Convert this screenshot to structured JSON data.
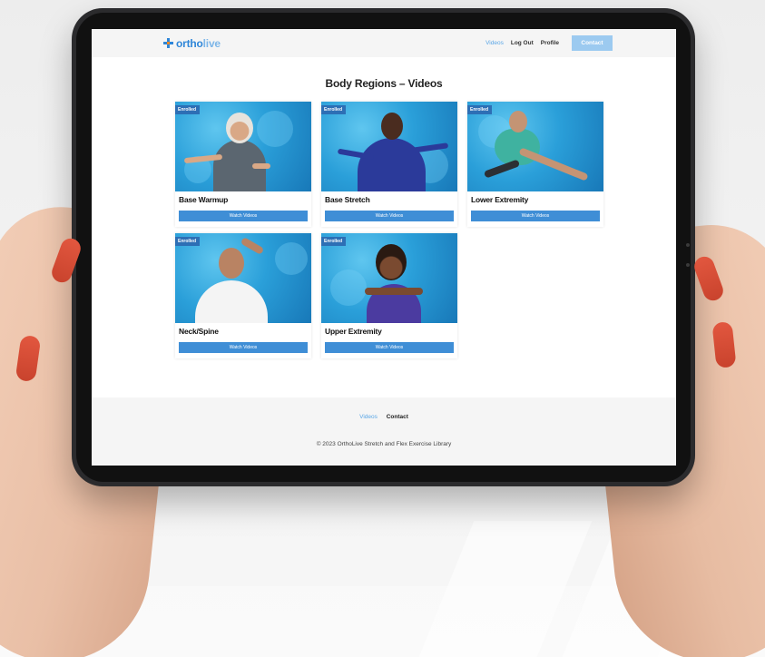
{
  "site": {
    "logo_brand": "ortho",
    "logo_rest": "live"
  },
  "nav": {
    "items": [
      {
        "label": "Videos",
        "active": true
      },
      {
        "label": "Log Out",
        "active": false
      },
      {
        "label": "Profile",
        "active": false
      }
    ],
    "contact_label": "Contact"
  },
  "main": {
    "title": "Body Regions – Videos",
    "cards": [
      {
        "title": "Base Warmup",
        "badge": "Enrolled",
        "button": "Watch Videos"
      },
      {
        "title": "Base Stretch",
        "badge": "Enrolled",
        "button": "Watch Videos"
      },
      {
        "title": "Lower Extremity",
        "badge": "Enrolled",
        "button": "Watch Videos"
      },
      {
        "title": "Neck/Spine",
        "badge": "Enrolled",
        "button": "Watch Videos"
      },
      {
        "title": "Upper Extremity",
        "badge": "Enrolled",
        "button": "Watch Videos"
      }
    ]
  },
  "footer": {
    "nav": [
      {
        "label": "Videos",
        "active": true
      },
      {
        "label": "Contact",
        "active": false
      }
    ],
    "copyright": "© 2023 OrthoLive Stretch and Flex Exercise Library"
  },
  "colors": {
    "brand_blue": "#2f86d8",
    "button_blue": "#3f8ed6",
    "badge_blue": "#2d6fb5",
    "contact_button": "#9ccaf0",
    "nail_red": "#d24a33"
  }
}
